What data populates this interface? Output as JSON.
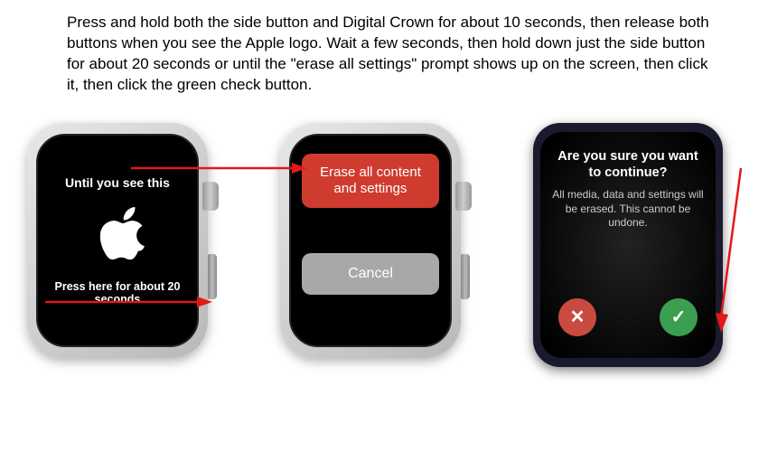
{
  "instructions": "Press and hold both the side button and Digital Crown for about 10 seconds, then release both buttons when you see the Apple logo. Wait a few seconds, then hold down just the side button for about 20 seconds or until the \"erase all settings\" prompt shows up on the screen, then click it, then click the green check button.",
  "watch1": {
    "top_text": "Until you see this",
    "bottom_text": "Press here for about 20 seconds"
  },
  "watch2": {
    "erase_label": "Erase all content and settings",
    "cancel_label": "Cancel"
  },
  "watch3": {
    "title": "Are you sure you want to continue?",
    "body": "All media, data and settings will be erased. This cannot be undone.",
    "cancel_icon": "✕",
    "confirm_icon": "✓"
  }
}
